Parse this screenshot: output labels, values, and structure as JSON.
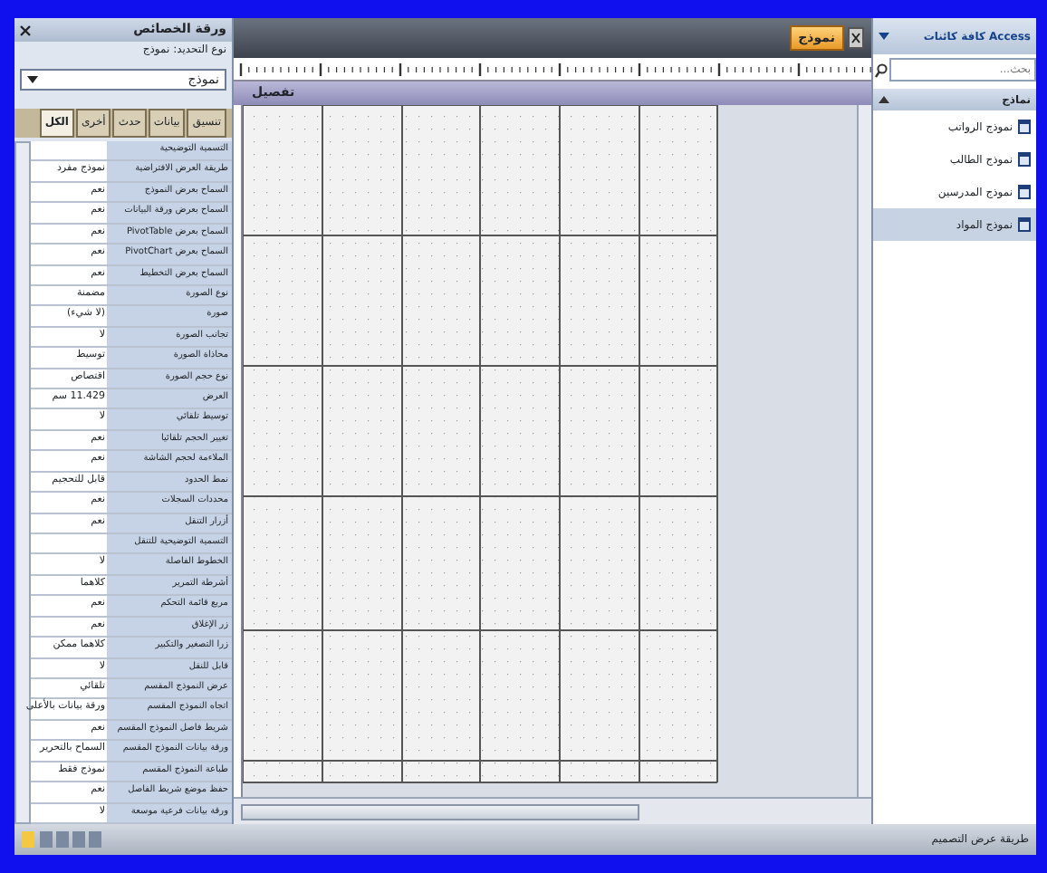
{
  "property_sheet": {
    "title": "ورقة الخصائص",
    "selection_type": "نوع التحديد: نموذج",
    "object": "نموذج",
    "tabs": [
      {
        "label": "تنسيق",
        "selected": false
      },
      {
        "label": "بيانات",
        "selected": false
      },
      {
        "label": "حدث",
        "selected": false
      },
      {
        "label": "أخرى",
        "selected": false
      },
      {
        "label": "الكل",
        "selected": true
      }
    ],
    "properties": [
      {
        "name": "التسمية التوضيحية"
      },
      {
        "name": "طريقة العرض الافتراضية",
        "value": "نموذج مفرد"
      },
      {
        "name": "السماح بعرض النموذج",
        "value": "نعم"
      },
      {
        "name": "السماح بعرض ورقة البيانات",
        "value": "نعم"
      },
      {
        "name": "السماح بعرض PivotTable",
        "value": "نعم"
      },
      {
        "name": "السماح بعرض PivotChart",
        "value": "نعم"
      },
      {
        "name": "السماح بعرض التخطيط",
        "value": "نعم"
      },
      {
        "name": "نوع الصورة",
        "value": "مضمنة"
      },
      {
        "name": "صورة",
        "value": "(لا شيء)"
      },
      {
        "name": "تجانب الصورة",
        "value": "لا"
      },
      {
        "name": "محاذاة الصورة",
        "value": "توسيط"
      },
      {
        "name": "نوع حجم الصورة",
        "value": "اقتصاص"
      },
      {
        "name": "العرض",
        "value": "11.429 سم"
      },
      {
        "name": "توسيط تلقائي",
        "value": "لا"
      },
      {
        "name": "تغيير الحجم تلقائيا",
        "value": "نعم"
      },
      {
        "name": "الملاءمة لحجم الشاشة",
        "value": "نعم"
      },
      {
        "name": "نمط الحدود",
        "value": "قابل للتحجيم"
      },
      {
        "name": "محددات السجلات",
        "value": "نعم"
      },
      {
        "name": "أزرار التنقل",
        "value": "نعم"
      },
      {
        "name": "التسمية التوضيحية للتنقل"
      },
      {
        "name": "الخطوط الفاصلة",
        "value": "لا"
      },
      {
        "name": "أشرطة التمرير",
        "value": "كلاهما"
      },
      {
        "name": "مربع قائمة التحكم",
        "value": "نعم"
      },
      {
        "name": "زر الإغلاق",
        "value": "نعم"
      },
      {
        "name": "زرا التصغير والتكبير",
        "value": "كلاهما ممكن"
      },
      {
        "name": "قابل للنقل",
        "value": "لا"
      },
      {
        "name": "عرض النموذج المقسم",
        "value": "تلقائي"
      },
      {
        "name": "اتجاه النموذج المقسم",
        "value": "ورقة بيانات بالأعلى"
      },
      {
        "name": "شريط فاصل النموذج المقسم",
        "value": "نعم"
      },
      {
        "name": "ورقة بيانات النموذج المقسم",
        "value": "السماح بالتحرير"
      },
      {
        "name": "طباعة النموذج المقسم",
        "value": "نموذج فقط"
      },
      {
        "name": "حفظ موضع شريط الفاصل",
        "value": "نعم"
      },
      {
        "name": "ورقة بيانات فرعية موسعة",
        "value": "لا"
      }
    ]
  },
  "designer": {
    "tab": "نموذج",
    "section": "تفصيل"
  },
  "navigation": {
    "title": "كافة كائنات Access",
    "search_placeholder": "بحث...",
    "group": "نماذج",
    "items": [
      {
        "label": "نموذج الرواتب",
        "selected": false
      },
      {
        "label": "نموذج الطالب",
        "selected": false
      },
      {
        "label": "نموذج المدرسين",
        "selected": false
      },
      {
        "label": "نموذج المواد",
        "selected": true
      }
    ]
  },
  "status_bar": {
    "text": "طريقة عرض التصميم"
  }
}
